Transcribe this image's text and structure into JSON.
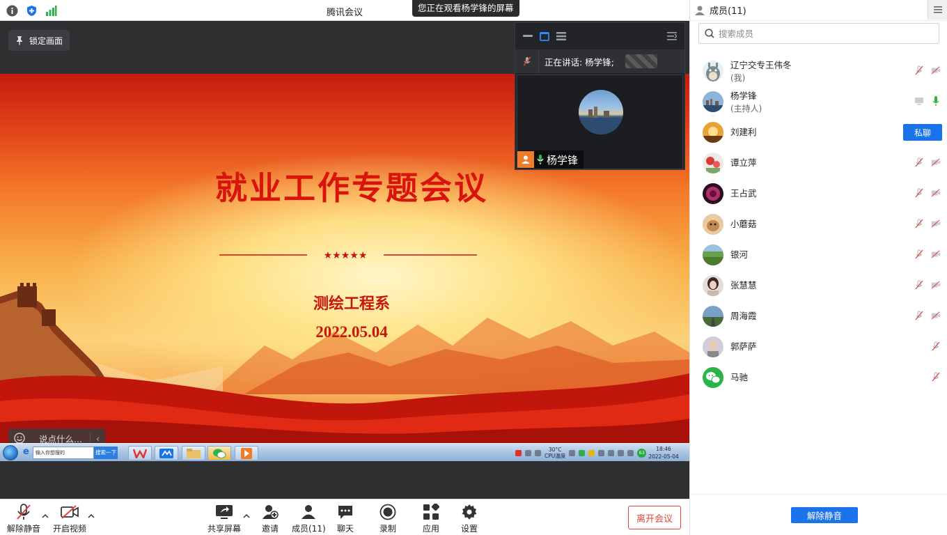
{
  "app": {
    "title": "腾讯会议",
    "watching_banner": "您正在观看杨学锋的屏幕"
  },
  "share": {
    "lock_label": "锁定画面",
    "slide": {
      "title": "就业工作专题会议",
      "subtitle": "测绘工程系",
      "date": "2022.05.04",
      "stars": "★★★★★"
    },
    "chat_placeholder": "说点什么...",
    "taskbar": {
      "search_placeholder": "输入你想搜的",
      "search_button": "搜索一下",
      "weather": "30°C",
      "cpu": "CPU温度",
      "badge": "63",
      "time": "18:46",
      "date": "2022-05-04"
    }
  },
  "speaker_window": {
    "speaking_label": "正在讲话: 杨学锋;",
    "name": "杨学锋"
  },
  "toolbar": {
    "unmute": "解除静音",
    "start_video": "开启视频",
    "share_screen": "共享屏幕",
    "invite": "邀请",
    "members": "成员(11)",
    "chat": "聊天",
    "record": "录制",
    "apps": "应用",
    "settings": "设置",
    "leave": "离开会议"
  },
  "panel": {
    "title": "成员(11)",
    "search_placeholder": "搜索成员",
    "private_chat": "私聊",
    "unmute_all": "解除静音",
    "members": [
      {
        "name": "辽宁交专王伟冬",
        "role": "(我)",
        "avatar": "totoro",
        "mic": "muted",
        "cam": "off"
      },
      {
        "name": "杨学锋",
        "role": "(主持人)",
        "avatar": "city",
        "mic": "on",
        "cam": "screen"
      },
      {
        "name": "刘建利",
        "role": "",
        "avatar": "sunset",
        "mic": "",
        "cam": ""
      },
      {
        "name": "谭立萍",
        "role": "",
        "avatar": "flowers",
        "mic": "muted",
        "cam": "off"
      },
      {
        "name": "王占武",
        "role": "",
        "avatar": "rose",
        "mic": "muted",
        "cam": "off"
      },
      {
        "name": "小蘑菇",
        "role": "",
        "avatar": "cat",
        "mic": "muted",
        "cam": "off"
      },
      {
        "name": "银河",
        "role": "",
        "avatar": "field",
        "mic": "muted",
        "cam": "off"
      },
      {
        "name": "张慧慧",
        "role": "",
        "avatar": "girl",
        "mic": "muted",
        "cam": "off"
      },
      {
        "name": "周海霞",
        "role": "",
        "avatar": "road",
        "mic": "muted",
        "cam": "off"
      },
      {
        "name": "郭萨萨",
        "role": "",
        "avatar": "portrait",
        "mic": "muted",
        "cam": ""
      },
      {
        "name": "马驰",
        "role": "",
        "avatar": "wechat",
        "mic": "muted",
        "cam": ""
      }
    ]
  },
  "colors": {
    "accent": "#1a73e8",
    "leave": "#e0443a",
    "slide_red": "#d8140c",
    "mic_on": "#2bb44a"
  }
}
